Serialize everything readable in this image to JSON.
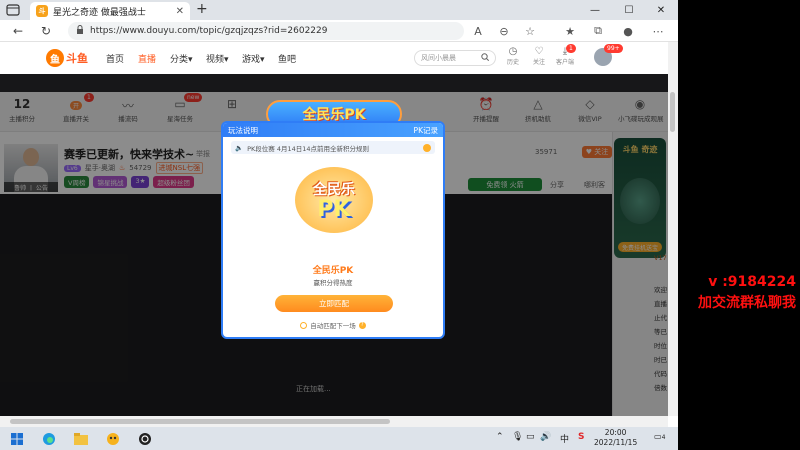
{
  "browser": {
    "tab_title": "星光之奇迹 做最强战士",
    "url": "https://www.douyu.com/topic/gzqjzqzs?rid=2602229",
    "new_tab": "+",
    "minimize": "—",
    "maximize": "☐",
    "close": "✕"
  },
  "site": {
    "logo_text": "斗鱼",
    "nav": [
      "首页",
      "直播",
      "分类▾",
      "视频▾",
      "游戏▾",
      "鱼吧"
    ],
    "search_placeholder": "风间小晨晨",
    "header_icons": [
      {
        "label": "历史"
      },
      {
        "label": "关注"
      },
      {
        "label": "客户端",
        "badge": "1"
      },
      {
        "label": "",
        "badge": "99+"
      }
    ]
  },
  "features": [
    {
      "top": "12",
      "label": "主播积分"
    },
    {
      "pill": "开",
      "label": "直播开关",
      "badge": "1"
    },
    {
      "label": "播流码"
    },
    {
      "label": "星海任务",
      "badge": "new"
    },
    {
      "label": ""
    },
    {
      "label": "开播提醒"
    },
    {
      "label": "挤机助航"
    },
    {
      "label": "微信VIP"
    },
    {
      "label": "小飞碟玩成观展"
    }
  ],
  "stream": {
    "title": "赛季已更新，快来学技术~",
    "report": "举报",
    "level": "Lv6",
    "category": "星手·奥湖",
    "heat": "54729",
    "tag_nsl": "进城NSL七强",
    "avatar_caption": "鲁帅 丨 公告",
    "tags": [
      {
        "text": "V周榜",
        "color": "#2b8a3e"
      },
      {
        "text": "锦星挑战",
        "color": "#b35ad6"
      },
      {
        "text": "3★",
        "color": "#7a42d6"
      },
      {
        "text": "超级粉丝团",
        "color": "#e0398a"
      }
    ],
    "viewers": "35971",
    "follow": "♥ 关注",
    "gift": "免费领 火箭",
    "share": "分享",
    "more": "哪利客",
    "loading": "正在加载..."
  },
  "promo": {
    "title": "斗鱼 奇迹",
    "button": "免费挂机送宝"
  },
  "chat": [
    "V17",
    "欢迎",
    "直播",
    "止代",
    "等已",
    "时位",
    "时已",
    "代码",
    "倍数"
  ],
  "modal": {
    "left_tab": "玩法说明",
    "right_tab": "PK记录",
    "notice": "PK段位赛  4月14日14点前用全新积分规则",
    "emblem_top": "全民乐",
    "emblem_bottom": "PK",
    "banner": "全民乐PK",
    "title": "全民乐PK",
    "subtitle": "赢积分得热度",
    "match_button": "立即匹配",
    "next_match": "自动匹配下一场"
  },
  "taskbar": {
    "time": "20:00",
    "date": "2022/11/15",
    "ime": "中",
    "notifications": "4"
  },
  "overlay_text": {
    "line1": "v  :9184224",
    "line2": "加交流群私聊我"
  },
  "colors": {
    "accent": "#ff7a1a",
    "modal_border": "#2f7df6",
    "overlay_red": "#ff1010"
  }
}
